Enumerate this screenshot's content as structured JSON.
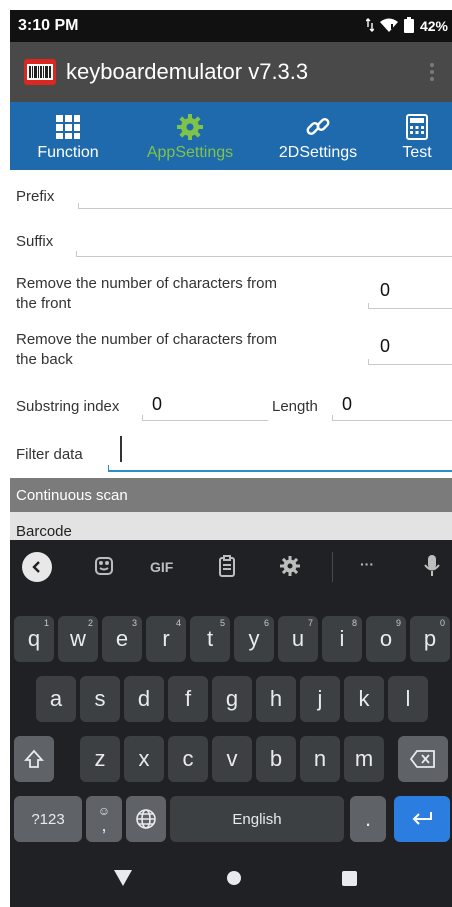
{
  "status_bar": {
    "time": "3:10 PM",
    "battery": "42%"
  },
  "app": {
    "title": "keyboardemulator v7.3.3"
  },
  "tabs": [
    {
      "label": "Function",
      "icon": "grid-icon"
    },
    {
      "label": "AppSettings",
      "icon": "gear-icon",
      "active": true
    },
    {
      "label": "2DSettings",
      "icon": "link-icon"
    },
    {
      "label": "Test",
      "icon": "calculator-icon"
    }
  ],
  "form": {
    "prefix_label": "Prefix",
    "prefix_value": "",
    "suffix_label": "Suffix",
    "suffix_value": "",
    "remove_front_label_1": "Remove the number of characters from",
    "remove_front_label_2": "the front",
    "remove_front_value": "0",
    "remove_back_label_1": "Remove the number of characters from",
    "remove_back_label_2": "the back",
    "remove_back_value": "0",
    "substring_label": "Substring index",
    "substring_value": "0",
    "length_label": "Length",
    "length_value": "0",
    "filter_label": "Filter data",
    "filter_value": ""
  },
  "sections": {
    "continuous": "Continuous scan",
    "barcode": "Barcode"
  },
  "keyboard": {
    "toolbar": {
      "gif": "GIF",
      "more": "···"
    },
    "row1": [
      {
        "k": "q",
        "h": "1"
      },
      {
        "k": "w",
        "h": "2"
      },
      {
        "k": "e",
        "h": "3"
      },
      {
        "k": "r",
        "h": "4"
      },
      {
        "k": "t",
        "h": "5"
      },
      {
        "k": "y",
        "h": "6"
      },
      {
        "k": "u",
        "h": "7"
      },
      {
        "k": "i",
        "h": "8"
      },
      {
        "k": "o",
        "h": "9"
      },
      {
        "k": "p",
        "h": "0"
      }
    ],
    "row2": [
      "a",
      "s",
      "d",
      "f",
      "g",
      "h",
      "j",
      "k",
      "l"
    ],
    "row3": [
      "z",
      "x",
      "c",
      "v",
      "b",
      "n",
      "m"
    ],
    "symbols": "?123",
    "emoji_hint": "☺",
    "comma": ",",
    "space": "English",
    "period": "."
  },
  "colors": {
    "tab_bar": "#1e6aad",
    "active_tab": "#7fc34a",
    "app_bar": "#494949",
    "enter_key": "#2c7de0"
  }
}
